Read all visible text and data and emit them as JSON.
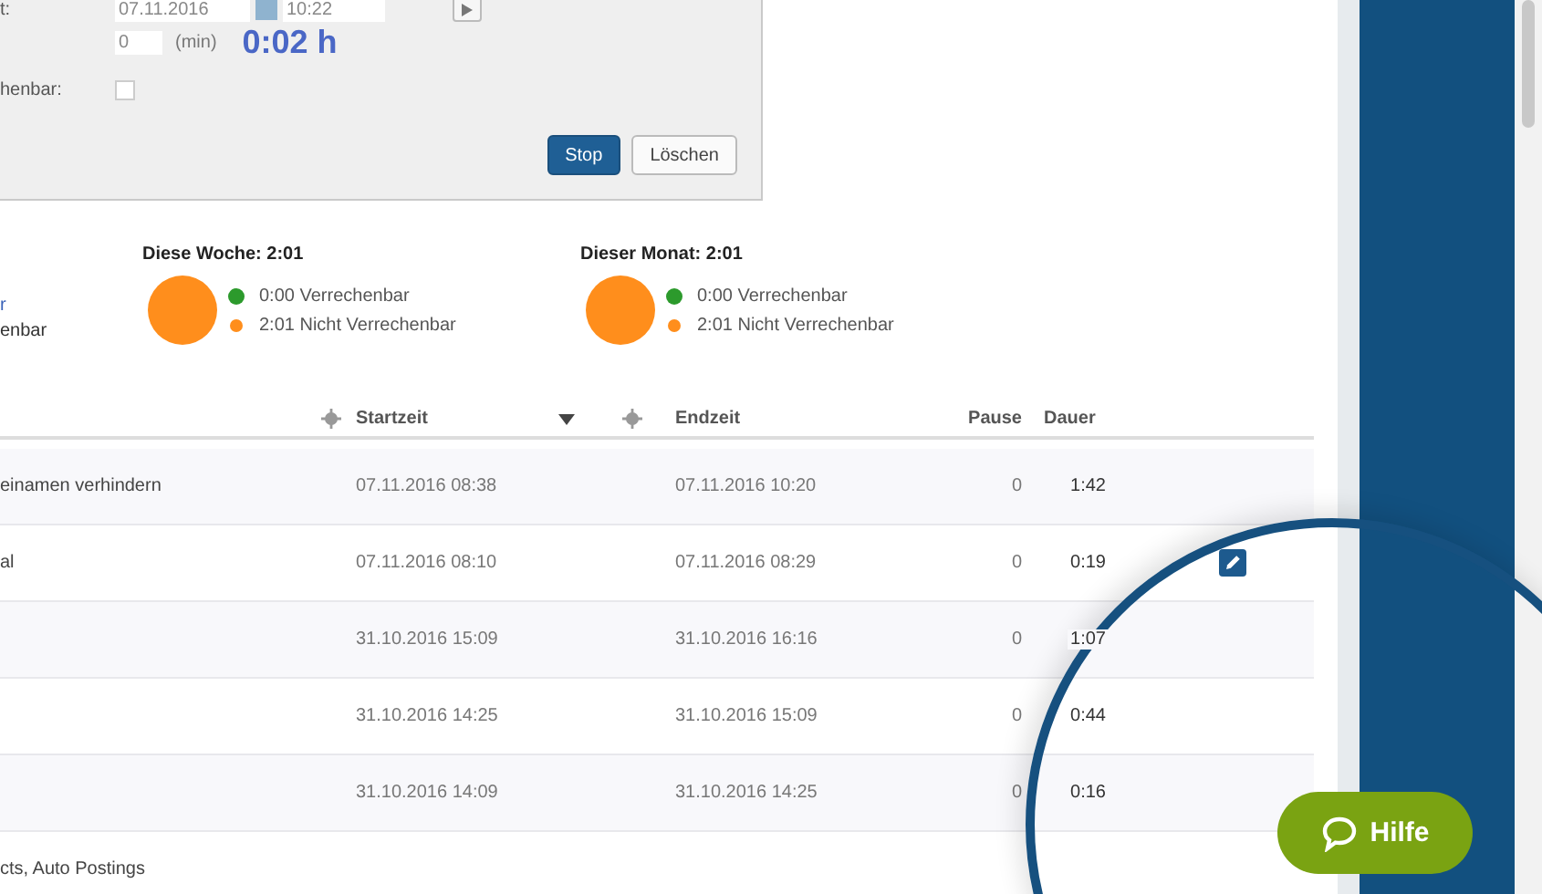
{
  "dialog": {
    "fields": [
      {
        "kind": "datetime",
        "label": "t:",
        "date": "07.11.2016",
        "time": "10:22"
      },
      {
        "kind": "pause",
        "value": "0",
        "unit": "(min)",
        "total": "0:02 h"
      },
      {
        "kind": "checkbox",
        "label": "henbar:",
        "checked": false
      }
    ],
    "buttons": [
      {
        "label": "Stop",
        "primary": true
      },
      {
        "label": "Löschen",
        "primary": false
      }
    ]
  },
  "partial_summary": [
    {
      "text": "r",
      "link": true
    },
    {
      "text": "enbar",
      "link": false
    }
  ],
  "summaries": [
    {
      "title": "Diese Woche: 2:01",
      "legend": [
        {
          "label": "0:00 Verrechenbar",
          "color": "#2c9a2c"
        },
        {
          "label": "2:01 Nicht Verrechenbar",
          "color": "#ff8e1c"
        }
      ]
    },
    {
      "title": "Dieser Monat: 2:01",
      "legend": [
        {
          "label": "0:00 Verrechenbar",
          "color": "#2c9a2c"
        },
        {
          "label": "2:01 Nicht Verrechenbar",
          "color": "#ff8e1c"
        }
      ]
    }
  ],
  "table": {
    "columns": [
      {
        "label": "Startzeit",
        "sort_handle": true,
        "sorted": true
      },
      {
        "label": "Endzeit",
        "sort_handle": true,
        "sorted": false
      },
      {
        "label": "Pause",
        "sort_handle": false,
        "sorted": false
      },
      {
        "label": "Dauer",
        "sort_handle": false,
        "sorted": false
      }
    ],
    "rows": [
      {
        "description": "einamen verhindern",
        "start": "07.11.2016 08:38",
        "end": "07.11.2016 10:20",
        "pause": "0",
        "duration": "1:42",
        "editable": false
      },
      {
        "description": "al",
        "start": "07.11.2016 08:10",
        "end": "07.11.2016 08:29",
        "pause": "0",
        "duration": "0:19",
        "editable": true
      },
      {
        "start": "31.10.2016 15:09",
        "end": "31.10.2016 16:16",
        "pause": "0",
        "duration": "1:07",
        "editable": false
      },
      {
        "start": "31.10.2016 14:25",
        "end": "31.10.2016 15:09",
        "pause": "0",
        "duration": "0:44",
        "editable": false
      },
      {
        "start": "31.10.2016 14:09",
        "end": "31.10.2016 14:25",
        "pause": "0",
        "duration": "0:16",
        "editable": false
      },
      {
        "description": "cts, Auto Postings",
        "editable": false
      }
    ]
  },
  "help_button": {
    "label": "Hilfe"
  }
}
